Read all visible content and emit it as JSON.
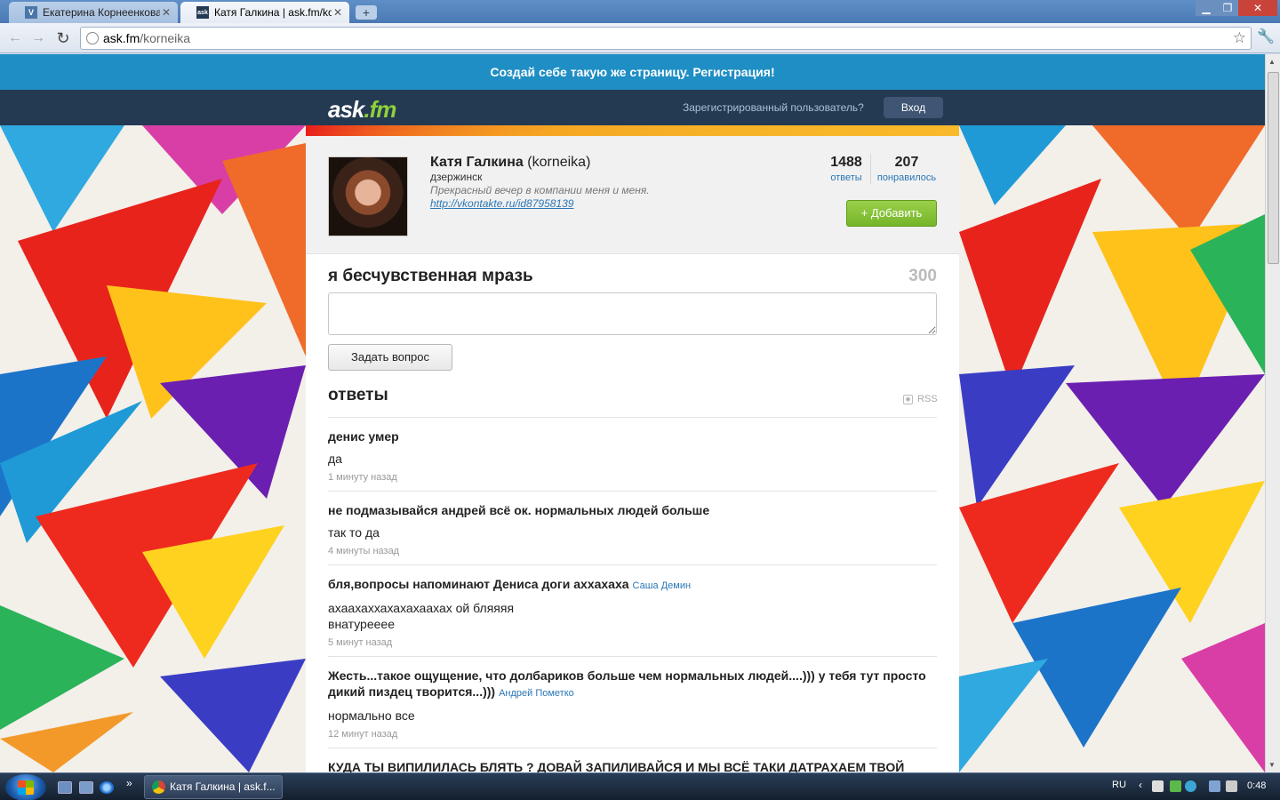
{
  "browser": {
    "tabs": [
      {
        "favicon": "V",
        "label": "Екатерина Корнеенкова",
        "active": false
      },
      {
        "favicon": "ask",
        "label": "Катя Галкина | ask.fm/korr",
        "active": true
      }
    ],
    "new_tab_label": "+",
    "url_host": "ask.fm",
    "url_path": "/korneika"
  },
  "promo": {
    "text": "Создай себе такую же страницу.",
    "link": "Регистрация!"
  },
  "topnav": {
    "logo_main": "ask",
    "logo_suffix": ".fm",
    "registered_prompt": "Зарегистрированный пользователь?",
    "login_label": "Вход"
  },
  "profile": {
    "name": "Катя Галкина",
    "username": "(korneika)",
    "city": "дзержинск",
    "bio": "Прекрасный вечер в компании меня и меня.",
    "link": "http://vkontakte.ru/id87958139",
    "answers_count": "1488",
    "answers_label": "ответы",
    "likes_count": "207",
    "likes_label": "понравилось",
    "add_label": "+ Добавить"
  },
  "ask": {
    "title": "я бесчувственная мразь",
    "char_count": "300",
    "input_value": "",
    "button_label": "Задать вопрос"
  },
  "answers_section": {
    "title": "ответы",
    "rss_label": "RSS"
  },
  "feed": [
    {
      "question": "денис умер",
      "author": "",
      "answer": "да",
      "time": "1 минуту назад"
    },
    {
      "question": "не подмазывайся андрей всё ок. нормальных людей больше",
      "author": "",
      "answer": "так то да",
      "time": "4 минуты назад"
    },
    {
      "question": "бля,вопросы напоминают Дениса доги аххахаха",
      "author": "Саша Демин",
      "answer": "ахаахаххахахахаахах ой бляяяя\nвнатурееее",
      "time": "5 минут назад"
    },
    {
      "question": "Жесть...такое ощущение, что долбариков больше чем нормальных людей....))) у тебя тут просто дикий пиздец творится...)))",
      "author": "Андрей Пометко",
      "answer": "нормально все",
      "time": "12 минут назад"
    },
    {
      "question": "КУДА ТЫ ВИПИЛИЛАСЬ БЛЯТЬ ? ДОВАЙ ЗАПИЛИВАЙСЯ И МЫ ВСЁ ТАКИ ДАТРАХАЕМ ТВОЙ",
      "author": "",
      "answer": "",
      "time": ""
    }
  ],
  "taskbar": {
    "task_label": "Катя Галкина | ask.f...",
    "lang": "RU",
    "time": "0:48"
  }
}
